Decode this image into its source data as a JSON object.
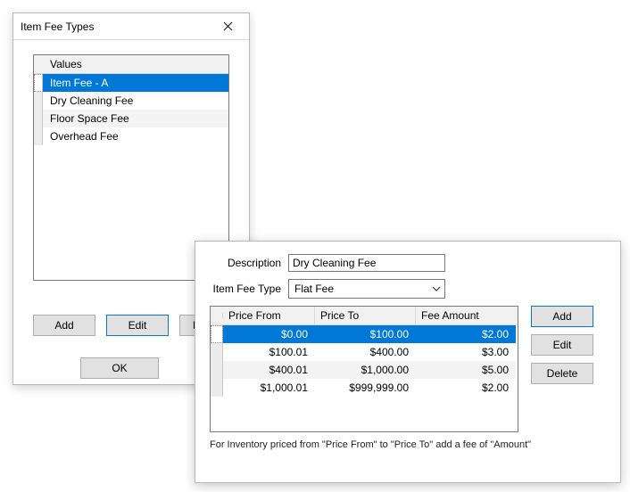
{
  "win1": {
    "title": "Item Fee Types",
    "header": "Values",
    "rows": [
      "Item Fee - A",
      "Dry Cleaning Fee",
      "Floor Space Fee",
      "Overhead Fee"
    ],
    "selected_index": 0,
    "buttons": {
      "add": "Add",
      "edit": "Edit",
      "del": "Dele",
      "ok": "OK"
    }
  },
  "win2": {
    "labels": {
      "description": "Description",
      "type": "Item Fee Type"
    },
    "description_value": "Dry Cleaning Fee",
    "type_value": "Flat Fee",
    "grid": {
      "headers": [
        "Price From",
        "Price To",
        "Fee Amount"
      ],
      "rows": [
        {
          "from": "$0.00",
          "to": "$100.00",
          "fee": "$2.00"
        },
        {
          "from": "$100.01",
          "to": "$400.00",
          "fee": "$3.00"
        },
        {
          "from": "$400.01",
          "to": "$1,000.00",
          "fee": "$5.00"
        },
        {
          "from": "$1,000.01",
          "to": "$999,999.00",
          "fee": "$2.00"
        }
      ],
      "selected_index": 0
    },
    "buttons": {
      "add": "Add",
      "edit": "Edit",
      "del": "Delete"
    },
    "hint": "For Inventory priced from \"Price From\" to \"Price To\" add a fee of \"Amount\""
  }
}
